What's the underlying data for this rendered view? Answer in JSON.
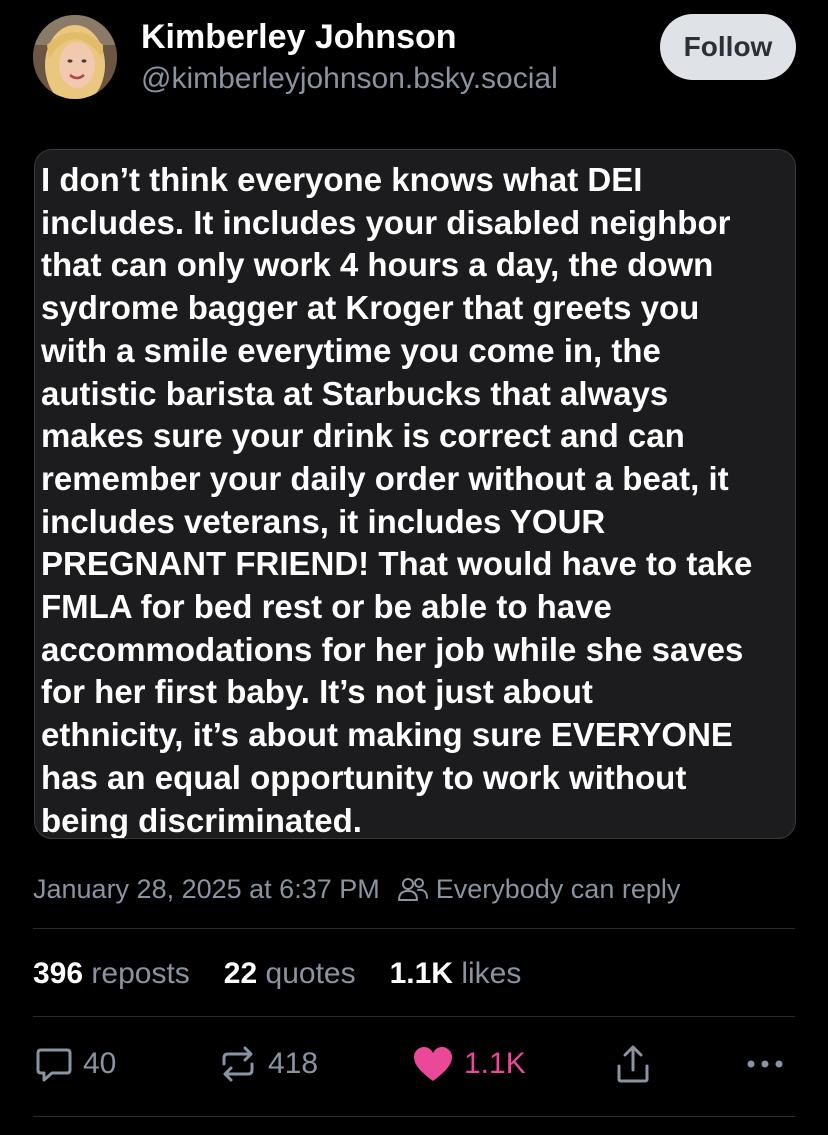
{
  "author": {
    "name": "Kimberley Johnson",
    "handle": "@kimberleyjohnson.bsky.social",
    "follow_label": "Follow"
  },
  "embed_lines": [
    "I don’t think everyone knows what DEI",
    "includes. It includes your disabled neighbor",
    "that can only work 4 hours a day, the down",
    "sydrome bagger at Kroger that greets you",
    "with a smile everytime you come in, the",
    "autistic barista at Starbucks that always",
    "makes sure your drink is correct and can",
    "remember your daily order without a beat, it",
    "includes veterans, it includes YOUR",
    "PREGNANT FRIEND! That would have to take",
    "FMLA for bed rest or be able to have",
    "accommodations for her job while she saves",
    "for her first baby. It’s not just about",
    "ethnicity, it’s about making sure EVERYONE",
    "has an equal opportunity to work without",
    "being discriminated."
  ],
  "meta": {
    "timestamp": "January 28, 2025 at 6:37 PM",
    "reply_setting": "Everybody can reply"
  },
  "stats": {
    "reposts_count": "396",
    "reposts_label": "reposts",
    "quotes_count": "22",
    "quotes_label": "quotes",
    "likes_count": "1.1K",
    "likes_label": "likes"
  },
  "actions": {
    "reply_count": "40",
    "repost_count": "418",
    "like_count": "1.1K"
  },
  "icons": {
    "reply": "speech-bubble-icon",
    "repost": "repost-arrows-icon",
    "like": "heart-icon",
    "share": "share-icon",
    "more": "ellipsis-icon",
    "audience": "people-icon"
  },
  "colors": {
    "background": "#000000",
    "muted_text": "#8a93a0",
    "like_pink": "#ec4899",
    "follow_button_bg": "#dfe3e8",
    "embed_bg": "#1c1c1e"
  }
}
